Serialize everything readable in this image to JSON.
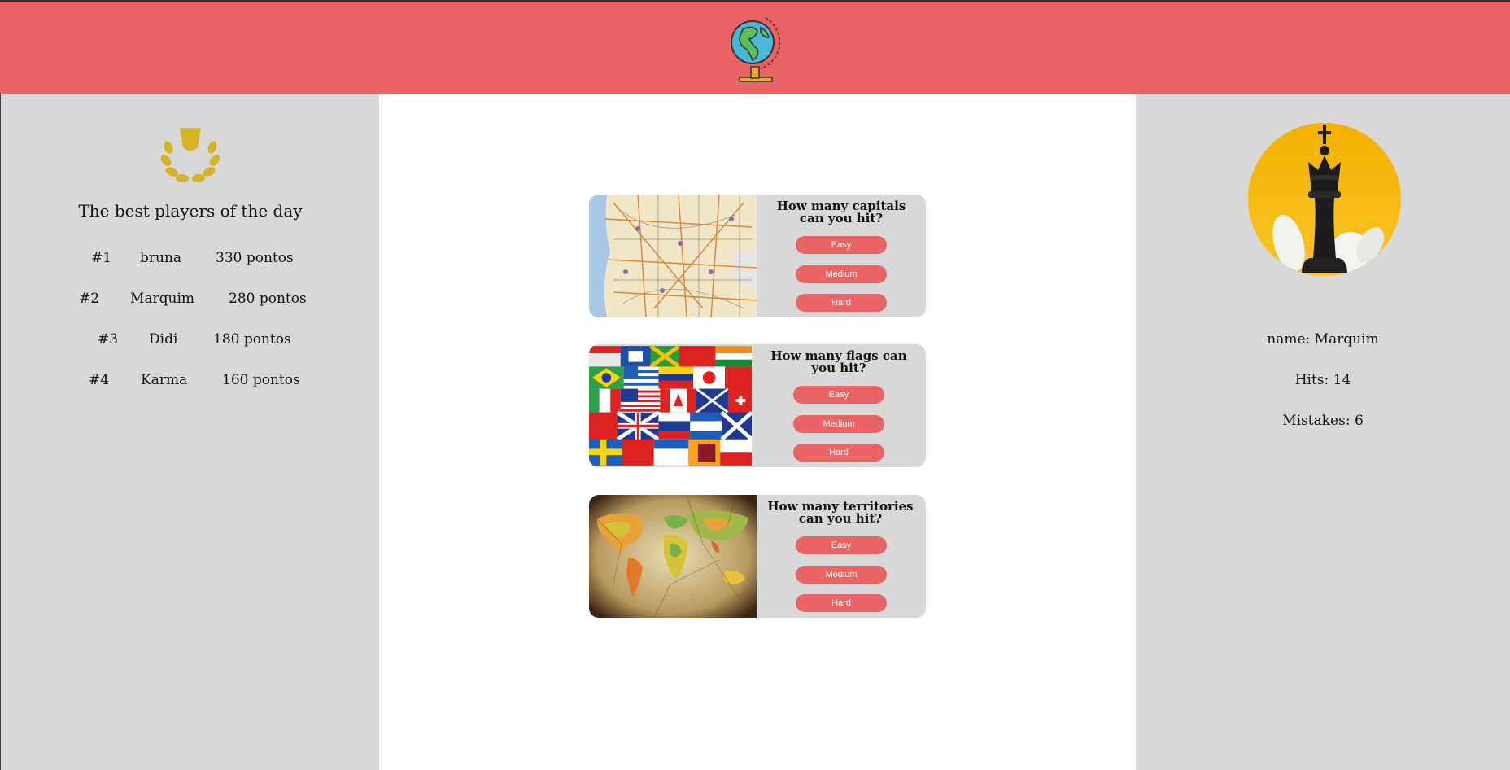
{
  "header": {
    "logo_icon": "globe-icon",
    "accent": "#ea6365"
  },
  "leaderboard": {
    "icon": "trophy-icon",
    "title": "The best players of the day",
    "players": [
      {
        "rank": "#1",
        "name": "bruna",
        "score": "330 pontos"
      },
      {
        "rank": "#2",
        "name": "Marquim",
        "score": "280 pontos"
      },
      {
        "rank": "#3",
        "name": "Didi",
        "score": "180 pontos"
      },
      {
        "rank": "#4",
        "name": "Karma",
        "score": "160 pontos"
      }
    ]
  },
  "quizzes": [
    {
      "image": "road-map-image",
      "question": "How many capitals can you hit?",
      "buttons": [
        "Easy",
        "Medium",
        "Hard"
      ]
    },
    {
      "image": "world-flags-image",
      "question": "How many flags can you hit?",
      "buttons": [
        "Easy",
        "Medium",
        "Hard"
      ]
    },
    {
      "image": "world-map-image",
      "question": "How many territories can you hit?",
      "buttons": [
        "Easy",
        "Medium",
        "Hard"
      ]
    }
  ],
  "profile": {
    "avatar_icon": "chess-queen-icon",
    "name": "name: Marquim",
    "hits": "Hits: 14",
    "mistakes": "Mistakes: 6"
  }
}
